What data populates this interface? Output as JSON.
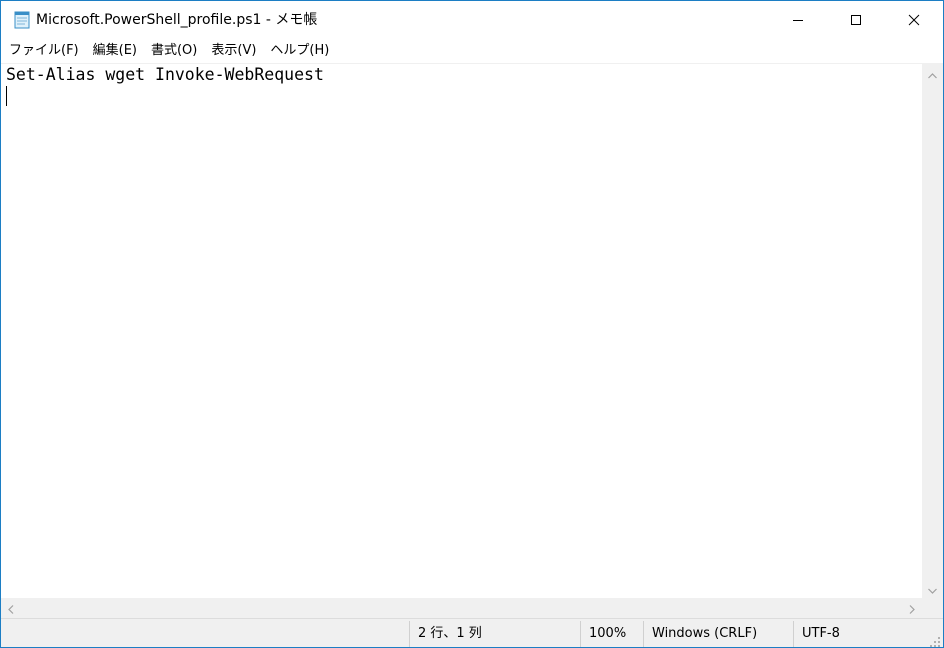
{
  "window": {
    "title": "Microsoft.PowerShell_profile.ps1 - メモ帳",
    "accent_color": "#1c7ec4",
    "icons": {
      "app": "notepad-icon",
      "minimize": "minimize-icon",
      "maximize": "maximize-icon",
      "close": "close-icon"
    }
  },
  "menu": {
    "items": [
      {
        "label": "ファイル(F)"
      },
      {
        "label": "編集(E)"
      },
      {
        "label": "書式(O)"
      },
      {
        "label": "表示(V)"
      },
      {
        "label": "ヘルプ(H)"
      }
    ]
  },
  "editor": {
    "lines": [
      "Set-Alias wget Invoke-WebRequest",
      ""
    ]
  },
  "statusbar": {
    "position": "2 行、1 列",
    "zoom": "100%",
    "line_ending": "Windows (CRLF)",
    "encoding": "UTF-8"
  }
}
